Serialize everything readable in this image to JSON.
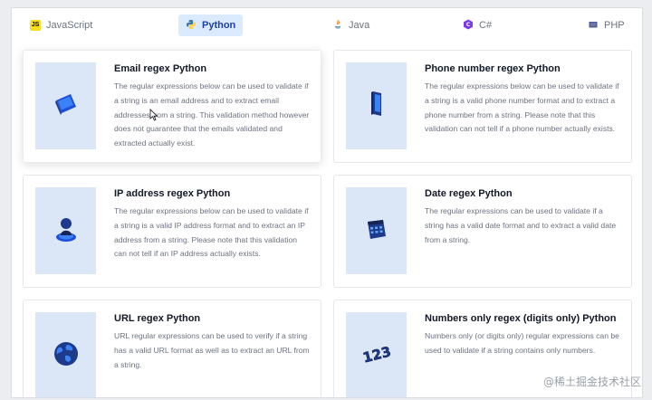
{
  "tabs": [
    {
      "label": "JavaScript",
      "icon": "javascript-icon"
    },
    {
      "label": "Python",
      "icon": "python-icon",
      "active": true
    },
    {
      "label": "Java",
      "icon": "java-icon"
    },
    {
      "label": "C#",
      "icon": "csharp-icon"
    },
    {
      "label": "PHP",
      "icon": "php-icon"
    }
  ],
  "cards": [
    {
      "title": "Email regex Python",
      "icon": "email-card-icon",
      "description": "The regular expressions below can be used to validate if a string is an email address and to extract email addresses from a string. This validation method however does not guarantee that the emails validated and extracted actually exist."
    },
    {
      "title": "Phone number regex Python",
      "icon": "phone-icon",
      "description": "The regular expressions below can be used to validate if a string is a valid phone number format and to extract a phone number from a string. Please note that this validation can not tell if a phone number actually exists."
    },
    {
      "title": "IP address regex Python",
      "icon": "user-location-icon",
      "description": "The regular expressions below can be used to validate if a string is a valid IP address format and to extract an IP address from a string. Please note that this validation can not tell if an IP address actually exists."
    },
    {
      "title": "Date regex Python",
      "icon": "calendar-icon",
      "description": "The regular expressions can be used to validate if a string has a valid date format and to extract a valid date from a string."
    },
    {
      "title": "URL regex Python",
      "icon": "globe-icon",
      "description": "URL regular expressions can be used to verify if a string has a valid URL format as well as to extract an URL from a string."
    },
    {
      "title": "Numbers only regex (digits only) Python",
      "icon": "numbers-123-icon",
      "description": "Numbers only (or digits only) regular expressions can be used to validate if a string contains only numbers."
    }
  ],
  "watermark": "@稀土掘金技术社区",
  "colors": {
    "accent": "#1e40af",
    "active_tab_bg": "#dbeafe",
    "thumb_bg": "#dbe7f7",
    "icon_blue": "#1d4ed8"
  }
}
